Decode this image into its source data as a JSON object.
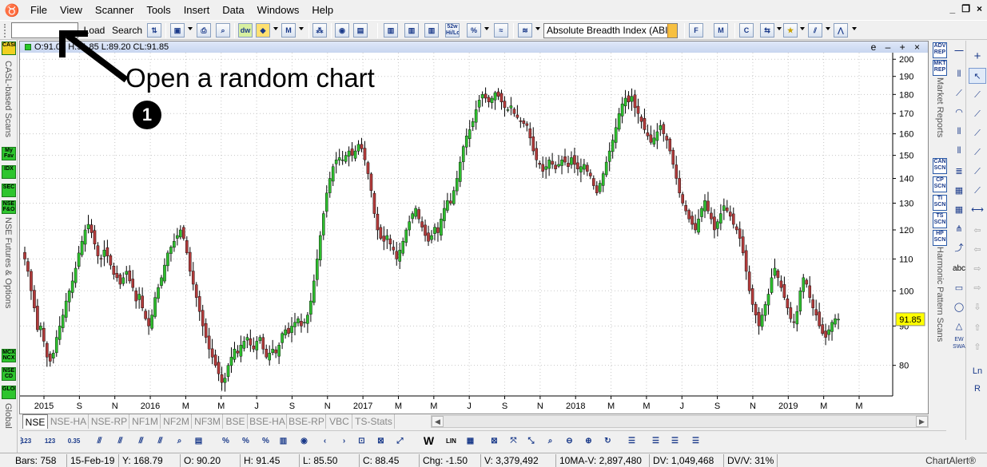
{
  "menu": {
    "items": [
      "File",
      "View",
      "Scanner",
      "Tools",
      "Insert",
      "Data",
      "Windows",
      "Help"
    ],
    "window_controls": [
      "_",
      "❐",
      "×"
    ]
  },
  "toolbar": {
    "symbol_value": "",
    "load_label": "Load",
    "search_label": "Search",
    "icons": [
      "52w Hi/Lo"
    ],
    "indicator_selected": "Absolute Breadth Index (ABI"
  },
  "left_panel": {
    "boxes_top": [
      "CASL"
    ],
    "label_casl": "CASL-based Scans",
    "boxes_mid": [
      "My Fav",
      "IDX",
      "SEC",
      "NSE F&O"
    ],
    "label_nse": "NSE Futures & Options",
    "boxes_bottom": [
      "MCX NCX",
      "NSE CD",
      "GLOBAL"
    ],
    "label_global": "Global"
  },
  "chart": {
    "header_ohlc": "O:91.00  H:91.85  L:89.20  CL:91.85",
    "header_controls": "e – + ×",
    "last_price": "91.85",
    "price_color": "#ffff00",
    "up_color": "#2dbd2d",
    "down_color": "#b03a3a"
  },
  "chart_data": {
    "type": "candlestick",
    "y_axis_ticks": [
      80,
      90,
      100,
      110,
      120,
      130,
      140,
      150,
      160,
      170,
      180,
      190,
      200
    ],
    "y_axis_scale": "log",
    "ylim": [
      73,
      203
    ],
    "x_axis_ticks": [
      "2015",
      "S",
      "N",
      "2016",
      "M",
      "M",
      "J",
      "S",
      "N",
      "2017",
      "M",
      "M",
      "J",
      "S",
      "N",
      "2018",
      "M",
      "M",
      "J",
      "S",
      "N",
      "2019",
      "M",
      "M"
    ],
    "grid": true,
    "closes": [
      110,
      106,
      100,
      95,
      89,
      90,
      86,
      82,
      81,
      83,
      87,
      90,
      93,
      97,
      100,
      103,
      107,
      112,
      116,
      120,
      122,
      119,
      115,
      111,
      110,
      113,
      111,
      108,
      105,
      104,
      102,
      104,
      106,
      103,
      101,
      97,
      99,
      95,
      92,
      90,
      93,
      98,
      101,
      104,
      108,
      112,
      114,
      116,
      118,
      120,
      117,
      112,
      106,
      102,
      98,
      94,
      90,
      87,
      84,
      82,
      80,
      78,
      76,
      77,
      80,
      82,
      84,
      83,
      85,
      86,
      87,
      85,
      84,
      86,
      87,
      84,
      82,
      83,
      84,
      83,
      85,
      88,
      89,
      88,
      90,
      91,
      92,
      90,
      91,
      93,
      97,
      103,
      110,
      118,
      126,
      134,
      140,
      145,
      148,
      149,
      148,
      150,
      152,
      150,
      152,
      155,
      153,
      148,
      142,
      135,
      126,
      120,
      117,
      116,
      118,
      115,
      113,
      110,
      113,
      116,
      120,
      123,
      126,
      128,
      124,
      121,
      118,
      116,
      118,
      121,
      119,
      124,
      128,
      131,
      130,
      135,
      140,
      147,
      154,
      159,
      162,
      166,
      172,
      177,
      180,
      178,
      176,
      178,
      181,
      179,
      176,
      173,
      172,
      174,
      170,
      168,
      166,
      165,
      164,
      158,
      152,
      148,
      146,
      143,
      145,
      148,
      146,
      144,
      146,
      148,
      147,
      145,
      149,
      146,
      144,
      145,
      146,
      143,
      141,
      137,
      134,
      138,
      142,
      147,
      152,
      157,
      163,
      170,
      175,
      178,
      176,
      179,
      173,
      170,
      166,
      162,
      159,
      156,
      158,
      161,
      164,
      160,
      157,
      152,
      146,
      140,
      134,
      130,
      127,
      124,
      122,
      120,
      124,
      128,
      131,
      127,
      124,
      120,
      123,
      126,
      129,
      127,
      125,
      122,
      120,
      117,
      112,
      106,
      100,
      96,
      93,
      90,
      93,
      96,
      99,
      104,
      107,
      104,
      101,
      98,
      95,
      92,
      91,
      94,
      100,
      104,
      102,
      98,
      95,
      93,
      90,
      88,
      87,
      89,
      91,
      92,
      91.85
    ],
    "source_note": ""
  },
  "exchange_tabs": [
    "NSE",
    "NSE-HA",
    "NSE-RP",
    "NF1M",
    "NF2M",
    "NF3M",
    "BSE",
    "BSE-HA",
    "BSE-RP",
    "VBC",
    "TS-Stats"
  ],
  "status": {
    "bars": "Bars: 758",
    "date": "15-Feb-19",
    "y": "Y: 168.79",
    "o": "O: 90.20",
    "h": "H: 91.45",
    "l": "L: 85.50",
    "c": "C: 88.45",
    "chg": "Chg: -1.50",
    "v": "V: 3,379,492",
    "ma": "10MA-V: 2,897,480",
    "dv": "DV: 1,049,468",
    "dvv": "DV/V: 31%",
    "brand": "ChartAlert®"
  },
  "scan_panel": {
    "boxes": [
      "ADV REP",
      "MKT REP",
      "CAN SCN",
      "CP SCN",
      "TI SCN",
      "TS SCN",
      "HP SCN"
    ],
    "label_market": "Market Reports",
    "label_harmonic": "Harmonic Pattern Scans"
  },
  "right_tools": {
    "labels": [
      "abc",
      "EW SWA",
      "Ln",
      "R"
    ]
  },
  "annotation": {
    "text": "Open a random chart",
    "step_number": "1"
  }
}
